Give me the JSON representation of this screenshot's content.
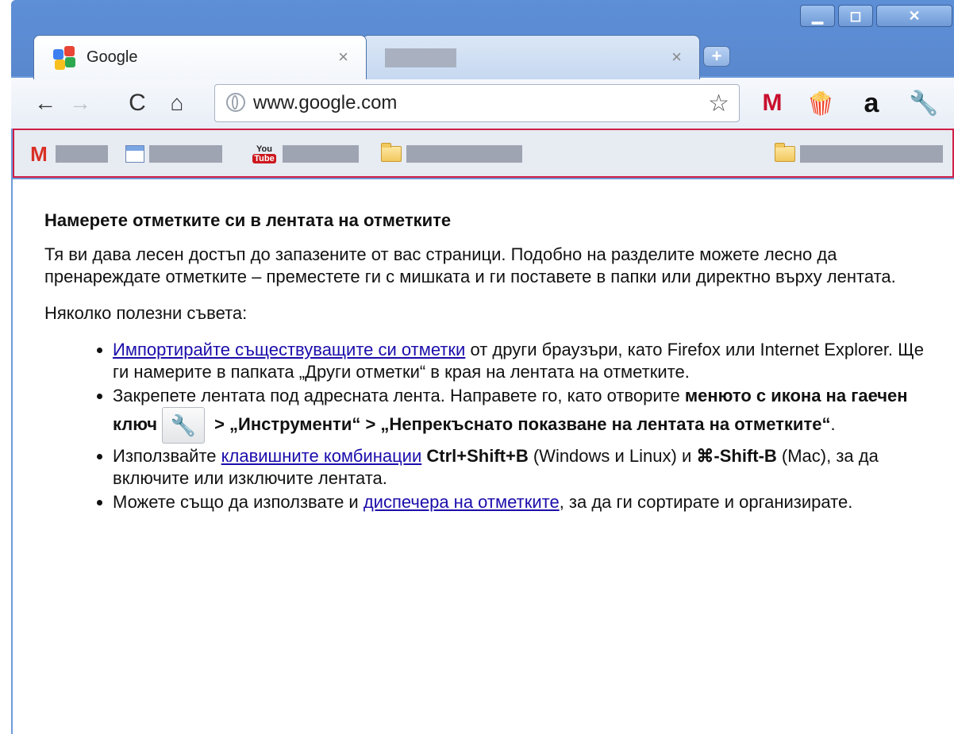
{
  "window": {
    "min_glyph": "▁",
    "max_glyph": "◻",
    "close_glyph": "✕"
  },
  "tabs": [
    {
      "title": "Google",
      "close_glyph": "×"
    },
    {
      "title": "",
      "close_glyph": "×"
    }
  ],
  "newtab_glyph": "+",
  "toolbar": {
    "back_glyph": "←",
    "forward_glyph": "→",
    "reload_glyph": "C",
    "home_glyph": "⌂",
    "url": "www.google.com",
    "star_glyph": "☆",
    "ext_gmail": "M",
    "ext_popcorn": "🍿",
    "ext_amazon": "a",
    "ext_wrench": "🔧"
  },
  "bookmarks": {
    "gmail_glyph": "M",
    "youtube_top": "You",
    "youtube_bottom": "Tube"
  },
  "content": {
    "heading": "Намерете отметките си в лентата на отметките",
    "intro": "Тя ви дава лесен достъп до запазените от вас страници. Подобно на разделите можете лесно да пренареждате отметките – преместете ги с мишката и ги поставете в папки или директно върху лентата.",
    "tips_intro": "Няколко полезни съвета:",
    "tip1_link": "Импортирайте съществуващите си отметки",
    "tip1_rest": " от други браузъри, като Firefox или Internet Explorer. Ще ги намерите в папката „Други отметки“ в края на лентата на отметките.",
    "tip2_pre": "Закрепете лентата под адресната лента. Направете го, като отворите ",
    "tip2_bold1": "менюто с икона на гаечен ключ",
    "tip2_wrench": "🔧",
    "tip2_bold2": " > „Инструменти“ > „Непрекъснато показване на лентата на отметките“",
    "tip2_end": ".",
    "tip3_pre": "Използвайте ",
    "tip3_link": "клавишните комбинации",
    "tip3_bold1": " Ctrl+Shift+B",
    "tip3_mid": " (Windows и Linux) и ",
    "tip3_bold2": "⌘-Shift-B",
    "tip3_end": " (Mac), за да включите или изключите лентата.",
    "tip4_pre": "Можете също да използвате и ",
    "tip4_link": "диспечера на отметките",
    "tip4_end": ", за да ги сортирате и организирате."
  }
}
